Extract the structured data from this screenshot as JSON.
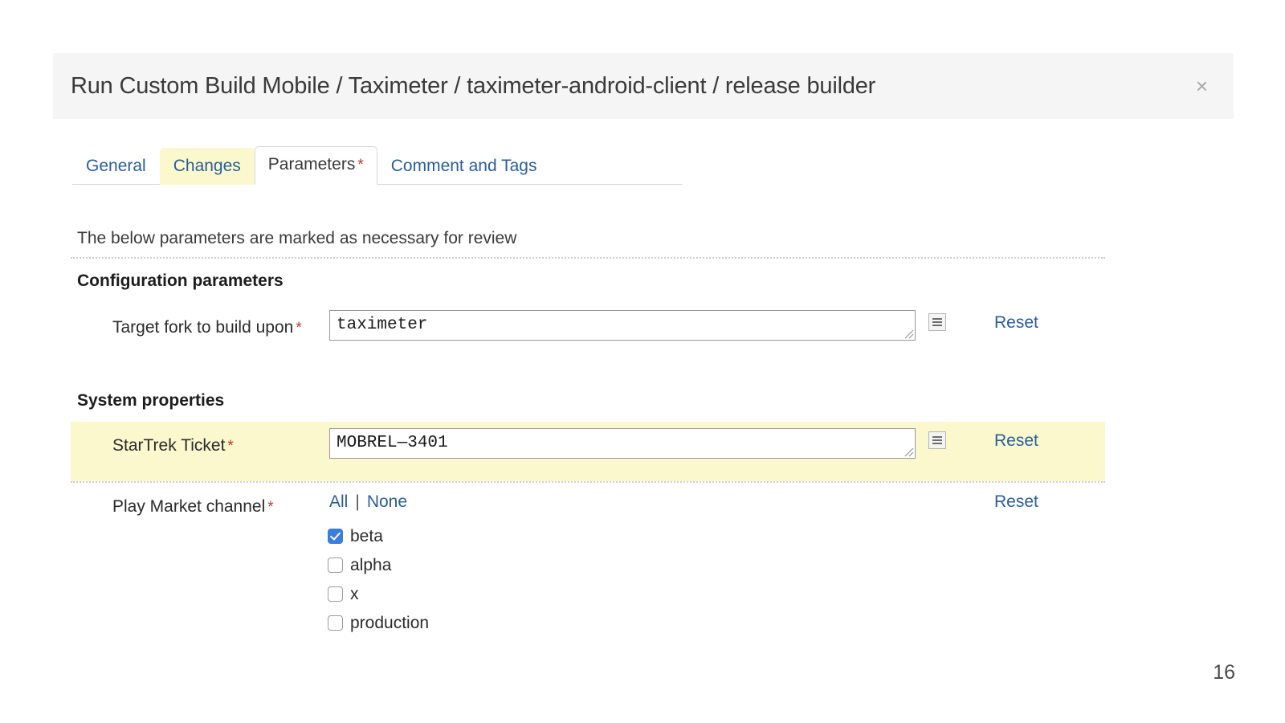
{
  "dialog": {
    "title": "Run Custom Build Mobile / Taximeter / taximeter-android-client / release builder",
    "close_label": "×"
  },
  "tabs": [
    {
      "label": "General",
      "state": "normal",
      "required": false
    },
    {
      "label": "Changes",
      "state": "highlighted",
      "required": false
    },
    {
      "label": "Parameters",
      "state": "active",
      "required": true
    },
    {
      "label": "Comment and Tags",
      "state": "normal",
      "required": false
    }
  ],
  "required_marker": "*",
  "notice": "The below parameters are marked as necessary for review",
  "sections": {
    "configuration": "Configuration parameters",
    "system": "System properties"
  },
  "parameters": {
    "fork": {
      "label": "Target fork to build upon",
      "required": true,
      "value": "taximeter",
      "list_icon": "list-lines-icon",
      "reset_label": "Reset"
    },
    "ticket": {
      "label": "StarTrek Ticket",
      "required": true,
      "value": "MOBREL—3401",
      "list_icon": "list-lines-icon",
      "reset_label": "Reset",
      "highlighted": true
    },
    "channel": {
      "label": "Play Market channel",
      "required": true,
      "all_label": "All",
      "separator": "|",
      "none_label": "None",
      "reset_label": "Reset",
      "options": [
        {
          "label": "beta",
          "checked": true
        },
        {
          "label": "alpha",
          "checked": false
        },
        {
          "label": "x",
          "checked": false
        },
        {
          "label": "production",
          "checked": false
        }
      ]
    }
  },
  "page_number": "16",
  "colors": {
    "link": "#2a5d9e",
    "required_star": "#c0392b",
    "highlight_yellow": "#fbf8cd",
    "header_bg": "#f5f5f5",
    "checkbox_checked": "#3b7ddd"
  }
}
